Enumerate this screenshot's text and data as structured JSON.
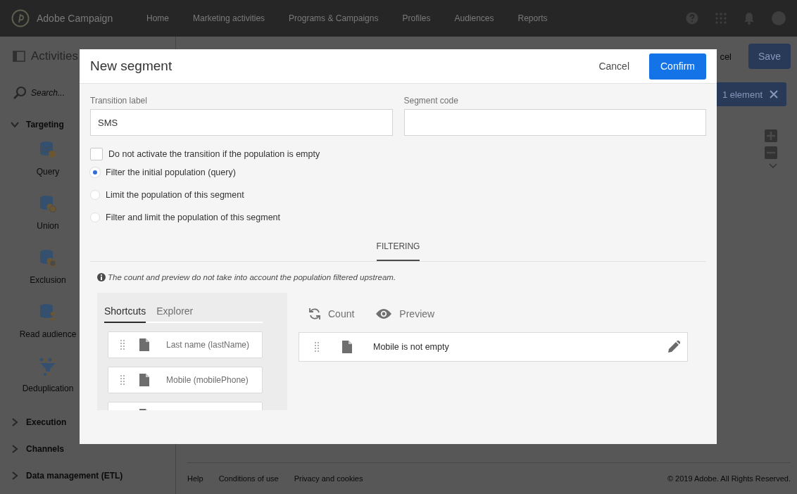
{
  "header": {
    "product": "Adobe Campaign",
    "nav": [
      {
        "label": "Home"
      },
      {
        "label": "Marketing activities"
      },
      {
        "label": "Programs & Campaigns"
      },
      {
        "label": "Profiles"
      },
      {
        "label": "Audiences"
      },
      {
        "label": "Reports"
      }
    ]
  },
  "toolbar": {
    "title": "Activities",
    "cancel": "cel",
    "save": "Save"
  },
  "sidebar": {
    "search_placeholder": "Search...",
    "groups": [
      {
        "label": "Targeting",
        "expanded": true,
        "items": [
          {
            "label": "Query",
            "kind": "query"
          },
          {
            "label": "Union",
            "kind": "union"
          },
          {
            "label": "Exclusion",
            "kind": "exclusion"
          },
          {
            "label": "Read audience",
            "kind": "audience"
          },
          {
            "label": "Deduplication",
            "kind": "dedup"
          }
        ]
      },
      {
        "label": "Execution",
        "expanded": false
      },
      {
        "label": "Channels",
        "expanded": false
      },
      {
        "label": "Data management (ETL)",
        "expanded": false
      }
    ]
  },
  "selection": {
    "label": "1 element"
  },
  "footer": {
    "links": [
      {
        "label": "Help"
      },
      {
        "label": "Conditions of use"
      },
      {
        "label": "Privacy and cookies"
      }
    ],
    "copyright": "© 2019 Adobe. All Rights Reserved."
  },
  "dialog": {
    "title": "New segment",
    "cancel": "Cancel",
    "confirm": "Confirm",
    "fields": [
      {
        "label": "Transition label",
        "value": "SMS"
      },
      {
        "label": "Segment code"
      }
    ],
    "checkbox": {
      "label": "Do not activate the transition if the population is empty",
      "checked": false
    },
    "radios": [
      {
        "label": "Filter the initial population (query)",
        "selected": true
      },
      {
        "label": "Limit the population of this segment",
        "selected": false
      },
      {
        "label": "Filter and limit the population of this segment",
        "selected": false
      }
    ],
    "tabs": [
      {
        "label": "FILTERING",
        "selected": true
      }
    ],
    "note": "The count and preview do not take into account the population filtered upstream.",
    "palette_tabs": [
      {
        "label": "Shortcuts",
        "selected": true
      },
      {
        "label": "Explorer",
        "selected": false
      }
    ],
    "shortcuts": [
      {
        "label": "Last name (lastName)",
        "kind": "field"
      },
      {
        "label": "Mobile (mobilePhone)",
        "kind": "field"
      },
      {
        "kind": "field"
      }
    ],
    "actions": [
      {
        "label": "Count",
        "kind": "refresh"
      },
      {
        "label": "Preview",
        "kind": "eye"
      }
    ],
    "rules": [
      {
        "label": "Mobile is not empty"
      }
    ]
  }
}
